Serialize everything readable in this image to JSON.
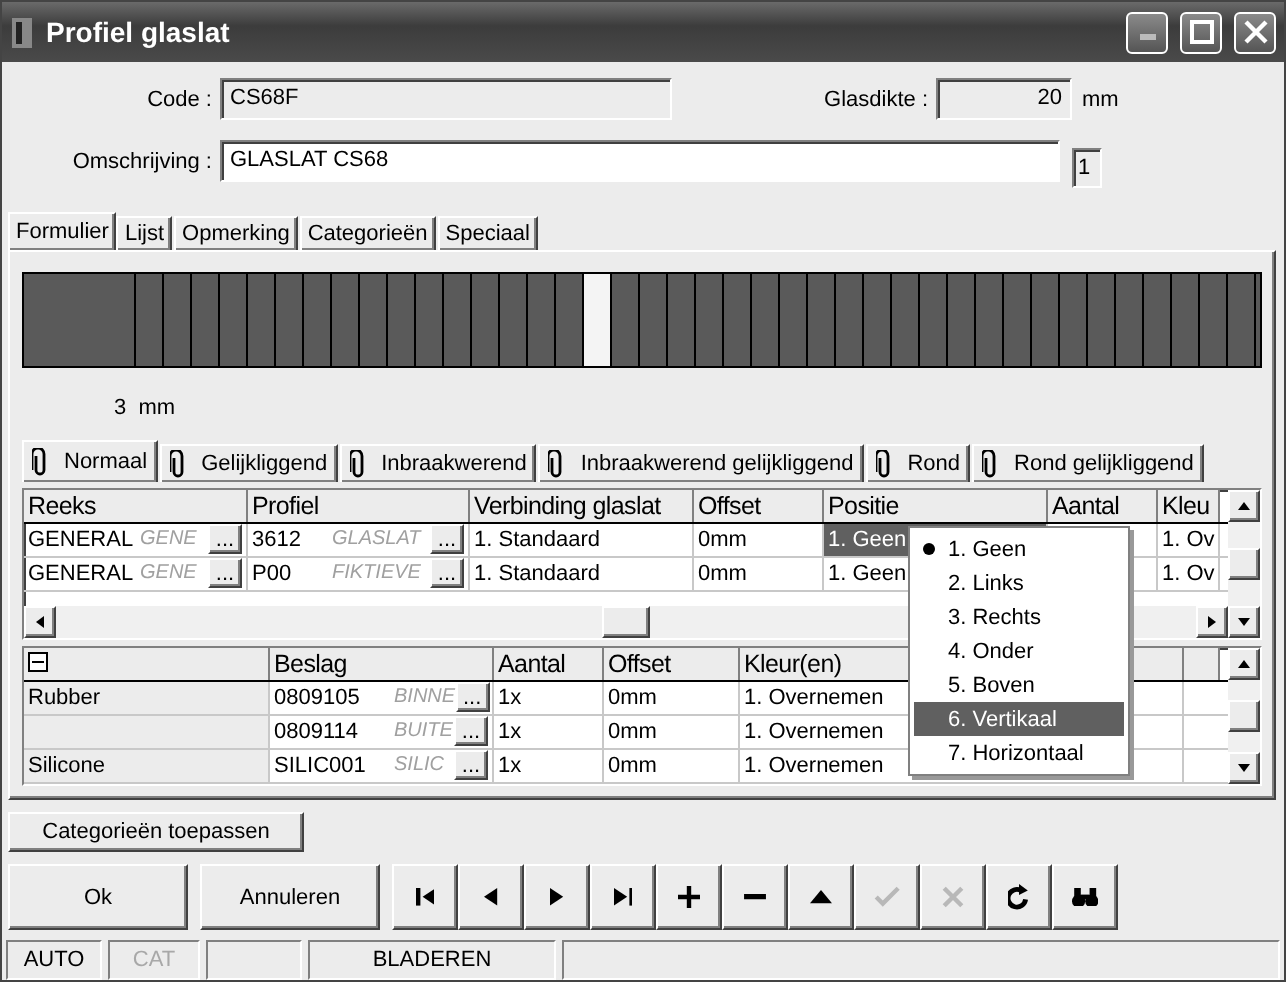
{
  "window": {
    "title": "Profiel glaslat"
  },
  "form": {
    "code_label": "Code :",
    "code": "CS68F",
    "glasdikte_label": "Glasdikte :",
    "glasdikte": "20",
    "glasdikte_unit": "mm",
    "omschrijving_label": "Omschrijving :",
    "omschrijving": "GLASLAT CS68",
    "counter": "1"
  },
  "tabs": [
    {
      "label": "Formulier",
      "selected": true
    },
    {
      "label": "Lijst",
      "selected": false
    },
    {
      "label": "Opmerking",
      "selected": false
    },
    {
      "label": "Categorieën",
      "selected": false
    },
    {
      "label": "Speciaal",
      "selected": false
    }
  ],
  "strip": {
    "reading": "3",
    "unit": "mm",
    "cells": [
      {
        "kind": "wide",
        "selected": false
      },
      {
        "kind": "narrow",
        "selected": false
      },
      {
        "kind": "narrow",
        "selected": false
      },
      {
        "kind": "narrow",
        "selected": false
      },
      {
        "kind": "narrow",
        "selected": false
      },
      {
        "kind": "narrow",
        "selected": false
      },
      {
        "kind": "narrow",
        "selected": false
      },
      {
        "kind": "narrow",
        "selected": false
      },
      {
        "kind": "narrow",
        "selected": false
      },
      {
        "kind": "narrow",
        "selected": false
      },
      {
        "kind": "narrow",
        "selected": false
      },
      {
        "kind": "narrow",
        "selected": false
      },
      {
        "kind": "narrow",
        "selected": false
      },
      {
        "kind": "narrow",
        "selected": false
      },
      {
        "kind": "narrow",
        "selected": false
      },
      {
        "kind": "narrow",
        "selected": false
      },
      {
        "kind": "narrow",
        "selected": false
      },
      {
        "kind": "narrow",
        "selected": true
      },
      {
        "kind": "narrow",
        "selected": false
      },
      {
        "kind": "narrow",
        "selected": false
      },
      {
        "kind": "narrow",
        "selected": false
      },
      {
        "kind": "narrow",
        "selected": false
      },
      {
        "kind": "narrow",
        "selected": false
      },
      {
        "kind": "narrow",
        "selected": false
      },
      {
        "kind": "narrow",
        "selected": false
      },
      {
        "kind": "narrow",
        "selected": false
      },
      {
        "kind": "narrow",
        "selected": false
      },
      {
        "kind": "narrow",
        "selected": false
      },
      {
        "kind": "narrow",
        "selected": false
      },
      {
        "kind": "narrow",
        "selected": false
      },
      {
        "kind": "narrow",
        "selected": false
      },
      {
        "kind": "narrow",
        "selected": false
      },
      {
        "kind": "narrow",
        "selected": false
      },
      {
        "kind": "narrow",
        "selected": false
      },
      {
        "kind": "narrow",
        "selected": false
      },
      {
        "kind": "narrow",
        "selected": false
      },
      {
        "kind": "narrow",
        "selected": false
      },
      {
        "kind": "narrow",
        "selected": false
      },
      {
        "kind": "narrow",
        "selected": false
      },
      {
        "kind": "narrow",
        "selected": false
      },
      {
        "kind": "narrow",
        "selected": false
      }
    ]
  },
  "subtabs": [
    {
      "label": "Normaal",
      "selected": true
    },
    {
      "label": "Gelijkliggend",
      "selected": false
    },
    {
      "label": "Inbraakwerend",
      "selected": false
    },
    {
      "label": "Inbraakwerend gelijkliggend",
      "selected": false
    },
    {
      "label": "Rond",
      "selected": false
    },
    {
      "label": "Rond gelijkliggend",
      "selected": false
    }
  ],
  "profiles_grid": {
    "columns": [
      "Reeks",
      "Profiel",
      "Verbinding glaslat",
      "Offset",
      "Positie",
      "Aantal",
      "Kleu"
    ],
    "rows": [
      {
        "reeks": "GENERAL",
        "reeks_desc": "GENE",
        "reeks_browse": "...",
        "profiel": "3612",
        "profiel_desc": "GLASLAT",
        "profiel_browse": "...",
        "verbinding": "1. Standaard",
        "offset": "0mm",
        "positie": "1. Geen",
        "positie_selected": true,
        "kleur": "1. Ov"
      },
      {
        "reeks": "GENERAL",
        "reeks_desc": "GENE",
        "reeks_browse": "...",
        "profiel": "P00",
        "profiel_desc": "FIKTIEVE",
        "profiel_browse": "...",
        "verbinding": "1. Standaard",
        "offset": "0mm",
        "positie": "1. Geen",
        "positie_selected": false,
        "kleur": "1. Ov"
      }
    ]
  },
  "positie_menu": [
    {
      "label": "1. Geen",
      "checked": true,
      "selected": false
    },
    {
      "label": "2. Links",
      "checked": false,
      "selected": false
    },
    {
      "label": "3. Rechts",
      "checked": false,
      "selected": false
    },
    {
      "label": "4. Onder",
      "checked": false,
      "selected": false
    },
    {
      "label": "5. Boven",
      "checked": false,
      "selected": false
    },
    {
      "label": "6. Vertikaal",
      "checked": false,
      "selected": true
    },
    {
      "label": "7. Horizontaal",
      "checked": false,
      "selected": false
    }
  ],
  "hardware_grid": {
    "expanded": true,
    "columns": [
      "Beslag",
      "Aantal",
      "Offset",
      "Kleur(en)"
    ],
    "rows": [
      {
        "group": "Rubber",
        "beslag": "0809105",
        "beslag_desc": "BINNE",
        "browse": "...",
        "aantal": "1x",
        "offset": "0mm",
        "kleur": "1. Overnemen"
      },
      {
        "beslag": "0809114",
        "beslag_desc": "BUITE",
        "browse": "...",
        "aantal": "1x",
        "offset": "0mm",
        "kleur": "1. Overnemen"
      },
      {
        "group": "Silicone",
        "beslag": "SILIC001",
        "beslag_desc": "SILIC",
        "browse": "...",
        "aantal": "1x",
        "offset": "0mm",
        "kleur": "1. Overnemen"
      }
    ]
  },
  "buttons": {
    "apply": "Categorieën toepassen",
    "ok": "Ok",
    "cancel": "Annuleren"
  },
  "toolbar": [
    {
      "kind": "first",
      "disabled": false
    },
    {
      "kind": "prev",
      "disabled": false
    },
    {
      "kind": "next",
      "disabled": false
    },
    {
      "kind": "last",
      "disabled": false
    },
    {
      "kind": "add",
      "disabled": false
    },
    {
      "kind": "remove",
      "disabled": false
    },
    {
      "kind": "up",
      "disabled": false
    },
    {
      "kind": "confirm",
      "disabled": true
    },
    {
      "kind": "cancel",
      "disabled": true
    },
    {
      "kind": "refresh",
      "disabled": false
    },
    {
      "kind": "find",
      "disabled": false
    }
  ],
  "status_bar": [
    {
      "kind": "text",
      "text": "AUTO",
      "disabled": false
    },
    {
      "kind": "text",
      "text": "CAT",
      "disabled": true
    },
    {
      "kind": "blank"
    },
    {
      "kind": "text",
      "text": "BLADEREN",
      "disabled": false
    },
    {
      "kind": "blank"
    }
  ]
}
